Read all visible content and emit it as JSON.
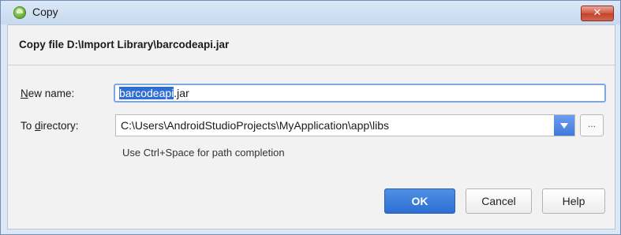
{
  "window": {
    "title": "Copy",
    "close_label": "✕"
  },
  "header": {
    "text": "Copy file D:\\Import Library\\barcodeapi.jar"
  },
  "new_name": {
    "mnemonic": "N",
    "label_rest": "ew name:",
    "value_selected": "barcodeapi",
    "value_rest": ".jar"
  },
  "to_directory": {
    "label_prefix": "To ",
    "mnemonic": "d",
    "label_rest": "irectory:",
    "value": "C:\\Users\\AndroidStudioProjects\\MyApplication\\app\\libs",
    "browse_label": "..."
  },
  "hint": "Use Ctrl+Space for path completion",
  "buttons": {
    "ok": "OK",
    "cancel": "Cancel",
    "help": "Help"
  },
  "colors": {
    "accent": "#2f6fd1",
    "ok_button": "#3a7bd9",
    "close_button": "#c9533d"
  },
  "icons": {
    "app": "android-studio-icon",
    "close": "close-icon",
    "dropdown": "chevron-down-icon"
  }
}
